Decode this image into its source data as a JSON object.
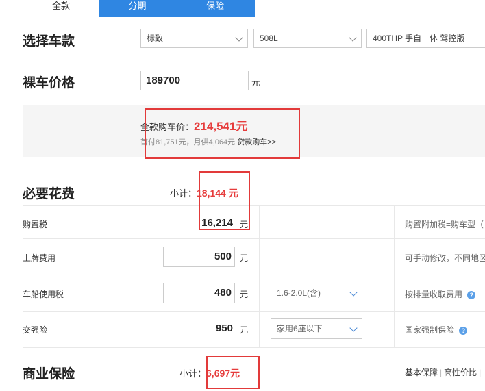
{
  "tabs": [
    {
      "label": "全款"
    },
    {
      "label": "分期"
    },
    {
      "label": "保险"
    }
  ],
  "select_car": {
    "title": "选择车款",
    "brand": "标致",
    "series": "508L",
    "model": "400THP 手自一体 驾控版"
  },
  "bare_price": {
    "title": "裸车价格",
    "value": "189700",
    "unit": "元"
  },
  "summary": {
    "total_label": "全款购车价：",
    "total_value": "214,541元",
    "loan_text": "首付81,751元，月供4,064元",
    "loan_link": "贷款购车>>"
  },
  "required": {
    "title": "必要花费",
    "subtotal_label": "小计：",
    "subtotal_value": "18,144 元",
    "rows": [
      {
        "label": "购置税",
        "value": "16,214",
        "unit": "元",
        "note": "购置附加税=购车型（"
      },
      {
        "label": "上牌费用",
        "value": "500",
        "unit": "元",
        "note": "可手动修改，不同地区"
      },
      {
        "label": "车船使用税",
        "value": "480",
        "unit": "元",
        "select": "1.6-2.0L(含)",
        "note": "按排量收取费用"
      },
      {
        "label": "交强险",
        "value": "950",
        "unit": "元",
        "select": "家用6座以下",
        "note": "国家强制保险"
      }
    ]
  },
  "commercial": {
    "title": "商业保险",
    "subtotal_label": "小计：",
    "subtotal_value": "6,697元",
    "options": [
      "基本保障",
      "高性价比"
    ]
  },
  "colors": {
    "accent": "#2f86e2",
    "price_red": "#e63c3c",
    "box_red": "#e23a3a"
  }
}
